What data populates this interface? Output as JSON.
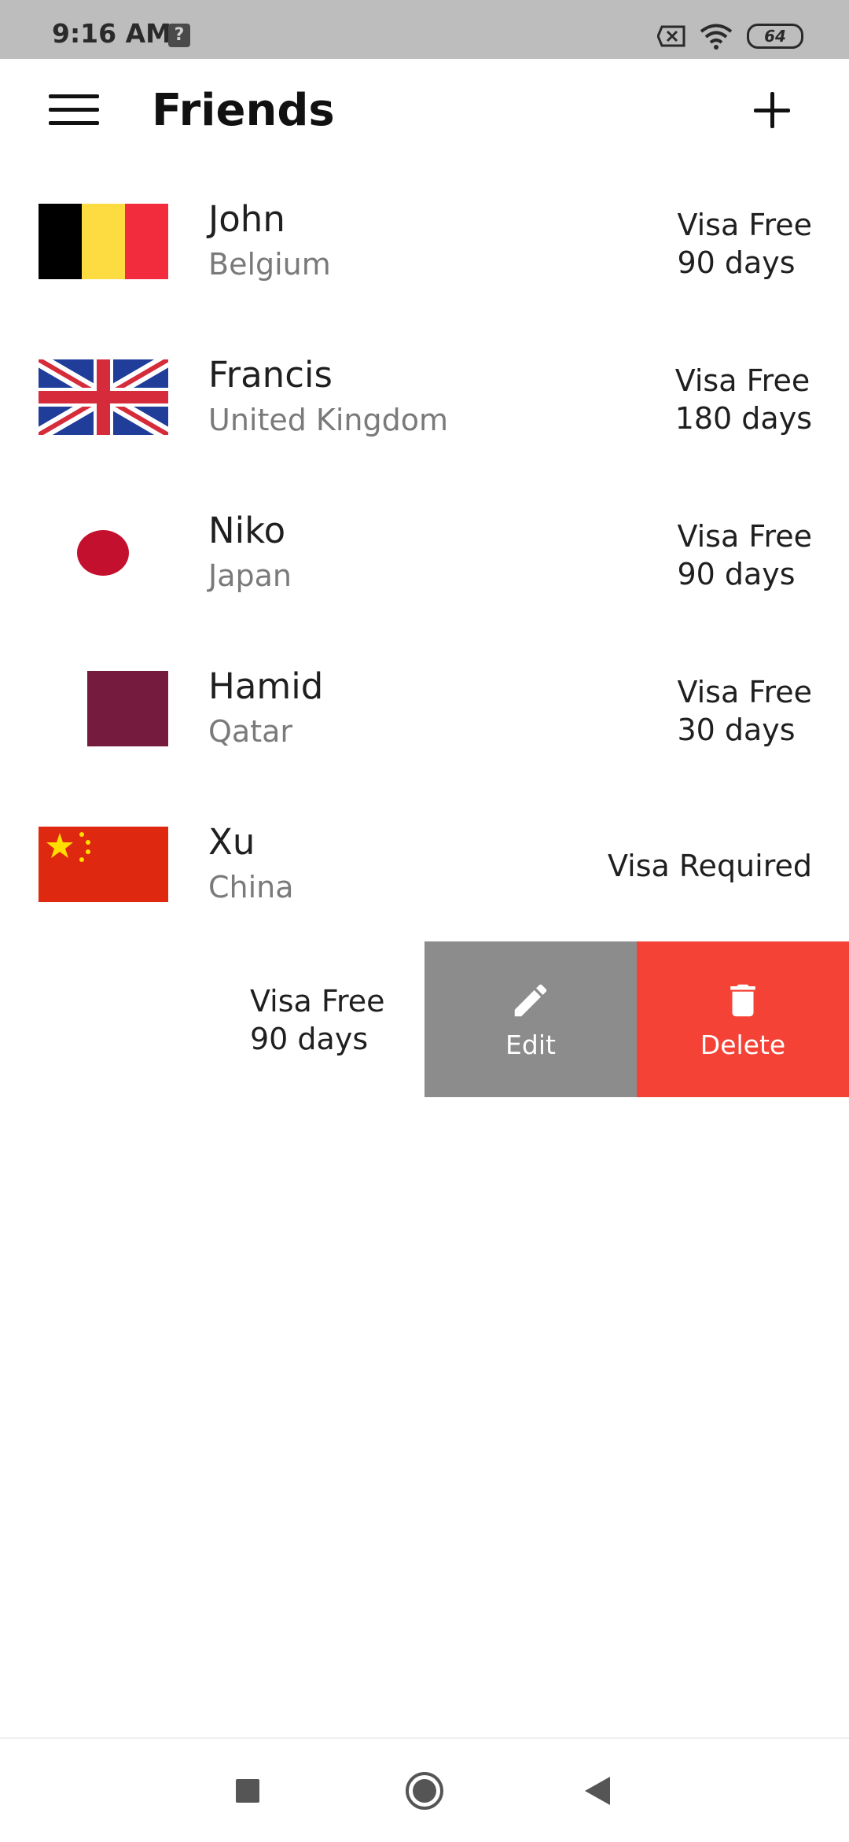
{
  "status_bar": {
    "time": "9:16 AM",
    "notification_icon": "question-icon",
    "notification_glyph": "?",
    "battery": "64"
  },
  "app_bar": {
    "title": "Friends",
    "menu_icon": "hamburger-menu-icon",
    "add_icon": "plus-icon"
  },
  "friends": [
    {
      "name": "John",
      "country": "Belgium",
      "visa": [
        "Visa Free",
        "90 days"
      ]
    },
    {
      "name": "Francis",
      "country": "United Kingdom",
      "visa": [
        "Visa Free",
        "180 days"
      ]
    },
    {
      "name": "Niko",
      "country": "Japan",
      "visa": [
        "Visa Free",
        "90 days"
      ]
    },
    {
      "name": "Hamid",
      "country": "Qatar",
      "visa": [
        "Visa Free",
        "30 days"
      ]
    },
    {
      "name": "Xu",
      "country": "China",
      "visa": [
        "Visa Required"
      ]
    }
  ],
  "swiped_row": {
    "visa": [
      "Visa Free",
      "90 days"
    ],
    "edit_label": "Edit",
    "delete_label": "Delete",
    "edit_color": "#8c8c8c",
    "delete_color": "#f44336"
  },
  "colors": {
    "status_bar_bg": "#bdbdbd",
    "background": "#ffffff",
    "secondary_text": "#7a7a7a"
  }
}
